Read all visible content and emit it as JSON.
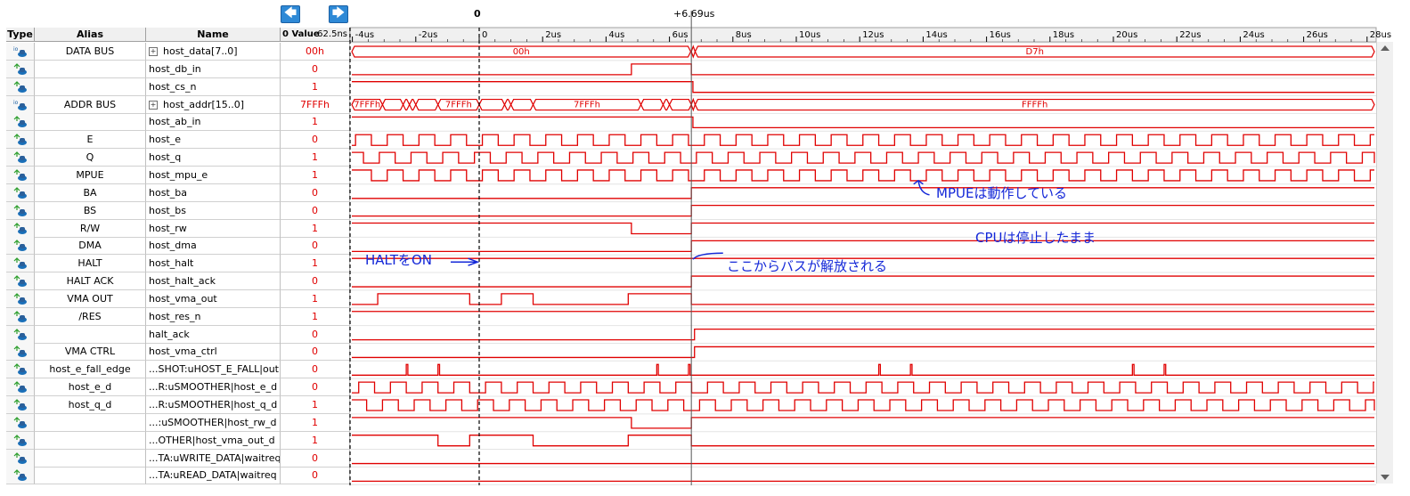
{
  "toolbar": {
    "scroll_left_label": "🡄",
    "scroll_right_label": "🡆",
    "cursor_zero_label": "0",
    "cursor_delta_label": "+6.69us"
  },
  "headers": {
    "type": "Type",
    "alias": "Alias",
    "name": "Name",
    "value": "0 Value",
    "value_ns": "62.5ns"
  },
  "time_axis": [
    "-4us",
    "-2us",
    "0",
    "2us",
    "4us",
    "6us",
    "8us",
    "10us",
    "12us",
    "14us",
    "16us",
    "18us",
    "20us",
    "22us",
    "24us",
    "26us",
    "28us"
  ],
  "rows": [
    {
      "alias": "DATA BUS",
      "name": "host_data[7..0]",
      "value": "00h",
      "bus": true,
      "expander": true
    },
    {
      "alias": "",
      "name": "host_db_in",
      "value": "0"
    },
    {
      "alias": "",
      "name": "host_cs_n",
      "value": "1"
    },
    {
      "alias": "ADDR BUS",
      "name": "host_addr[15..0]",
      "value": "7FFFh",
      "bus": true,
      "expander": true
    },
    {
      "alias": "",
      "name": "host_ab_in",
      "value": "1"
    },
    {
      "alias": "E",
      "name": "host_e",
      "value": "0"
    },
    {
      "alias": "Q",
      "name": "host_q",
      "value": "1"
    },
    {
      "alias": "MPUE",
      "name": "host_mpu_e",
      "value": "1"
    },
    {
      "alias": "BA",
      "name": "host_ba",
      "value": "0"
    },
    {
      "alias": "BS",
      "name": "host_bs",
      "value": "0"
    },
    {
      "alias": "R/W",
      "name": "host_rw",
      "value": "1"
    },
    {
      "alias": "DMA",
      "name": "host_dma",
      "value": "0"
    },
    {
      "alias": "HALT",
      "name": "host_halt",
      "value": "1"
    },
    {
      "alias": "HALT ACK",
      "name": "host_halt_ack",
      "value": "0"
    },
    {
      "alias": "VMA OUT",
      "name": "host_vma_out",
      "value": "1"
    },
    {
      "alias": "/RES",
      "name": "host_res_n",
      "value": "1"
    },
    {
      "alias": "",
      "name": "halt_ack",
      "value": "0"
    },
    {
      "alias": "VMA CTRL",
      "name": "host_vma_ctrl",
      "value": "0"
    },
    {
      "alias": "host_e_fall_edge",
      "name": "...SHOT:uHOST_E_FALL|out",
      "value": "0"
    },
    {
      "alias": "host_e_d",
      "name": "...R:uSMOOTHER|host_e_d",
      "value": "0"
    },
    {
      "alias": "host_q_d",
      "name": "...R:uSMOOTHER|host_q_d",
      "value": "1"
    },
    {
      "alias": "",
      "name": "...:uSMOOTHER|host_rw_d",
      "value": "1"
    },
    {
      "alias": "",
      "name": "...OTHER|host_vma_out_d",
      "value": "1"
    },
    {
      "alias": "",
      "name": "...TA:uWRITE_DATA|waitreq",
      "value": "0"
    },
    {
      "alias": "",
      "name": "...TA:uREAD_DATA|waitreq",
      "value": "0"
    }
  ],
  "bus_labels": {
    "data_before": "00h",
    "data_after": "D7h",
    "addr_first": "7FFFh",
    "addr_second": "7FFFh",
    "addr_third": "7FFFh",
    "addr_after": "FFFFh"
  },
  "annotations": {
    "halt_on": "HALTをON",
    "bus_release": "ここからバスが解放される",
    "mpue_running": "MPUEは動作している",
    "cpu_stopped": "CPUは停止したまま"
  },
  "colors": {
    "waveform": "#e00000",
    "annotation": "#1428d8",
    "cursor": "#000000"
  }
}
